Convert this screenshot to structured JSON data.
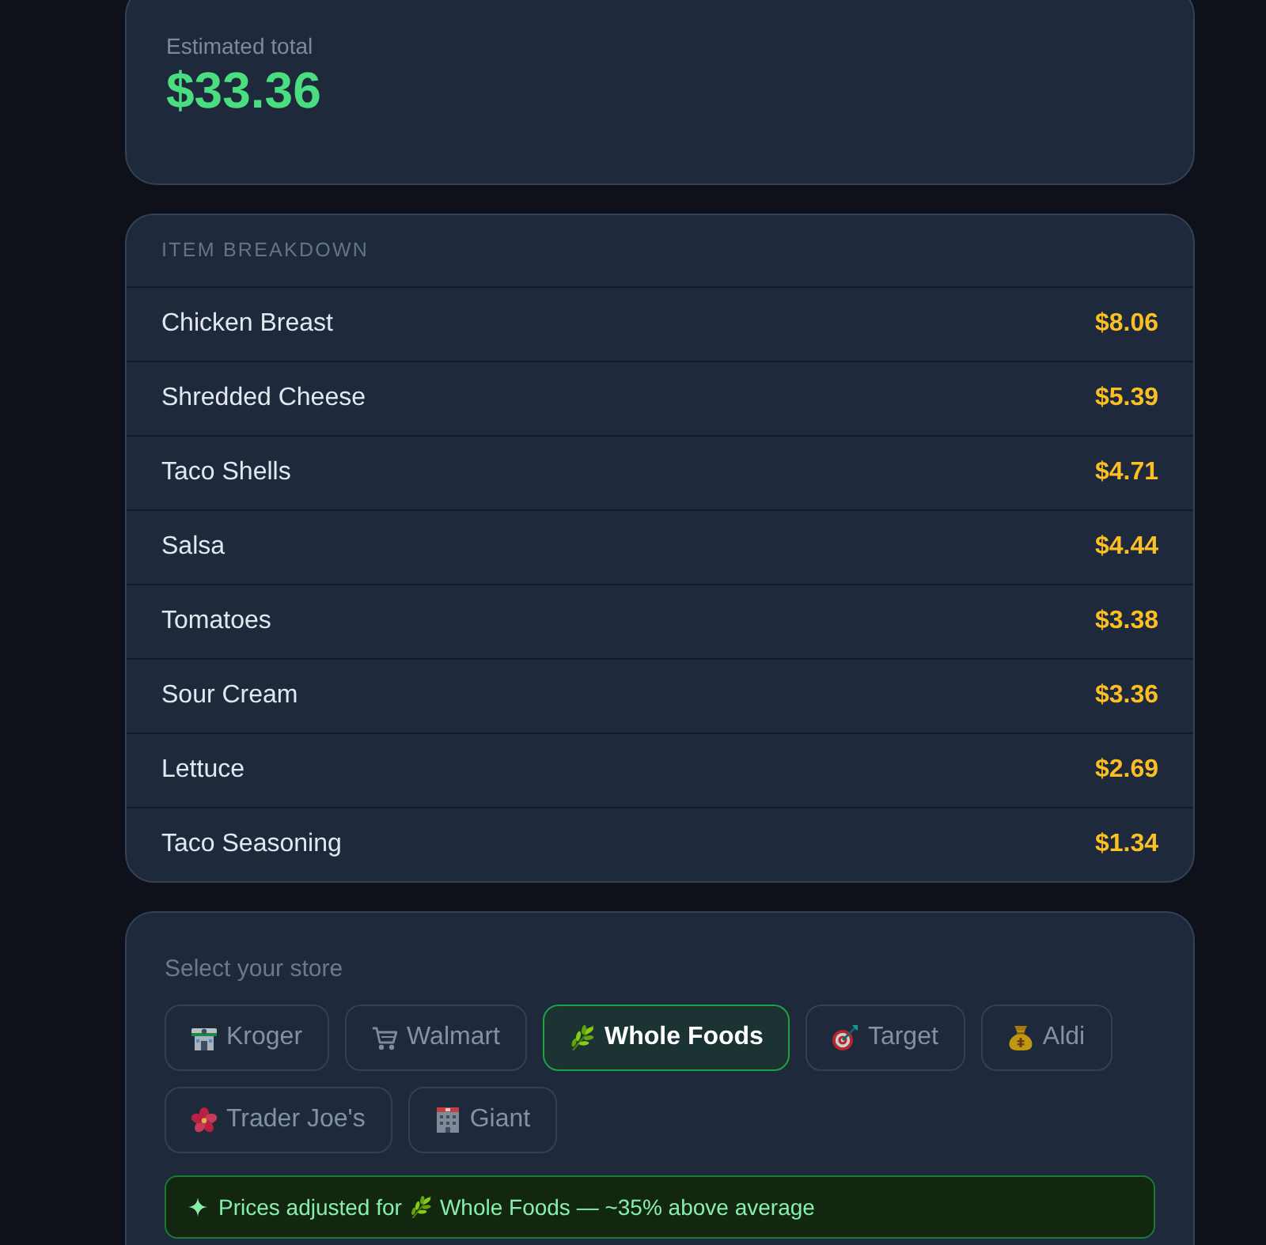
{
  "total": {
    "label": "Estimated total",
    "amount": "$33.36"
  },
  "breakdown": {
    "title": "ITEM BREAKDOWN",
    "items": [
      {
        "name": "Chicken Breast",
        "price": "$8.06"
      },
      {
        "name": "Shredded Cheese",
        "price": "$5.39"
      },
      {
        "name": "Taco Shells",
        "price": "$4.71"
      },
      {
        "name": "Salsa",
        "price": "$4.44"
      },
      {
        "name": "Tomatoes",
        "price": "$3.38"
      },
      {
        "name": "Sour Cream",
        "price": "$3.36"
      },
      {
        "name": "Lettuce",
        "price": "$2.69"
      },
      {
        "name": "Taco Seasoning",
        "price": "$1.34"
      }
    ]
  },
  "store_picker": {
    "label": "Select your store",
    "stores": [
      {
        "name": "Kroger",
        "selected": false
      },
      {
        "name": "Walmart",
        "selected": false
      },
      {
        "name": "Whole Foods",
        "selected": true
      },
      {
        "name": "Target",
        "selected": false
      },
      {
        "name": "Aldi",
        "selected": false
      },
      {
        "name": "Trader Joe's",
        "selected": false
      },
      {
        "name": "Giant",
        "selected": false
      }
    ]
  },
  "notice": {
    "prefix": "Prices adjusted for",
    "store": "Whole Foods",
    "suffix": "— ~35% above average"
  }
}
